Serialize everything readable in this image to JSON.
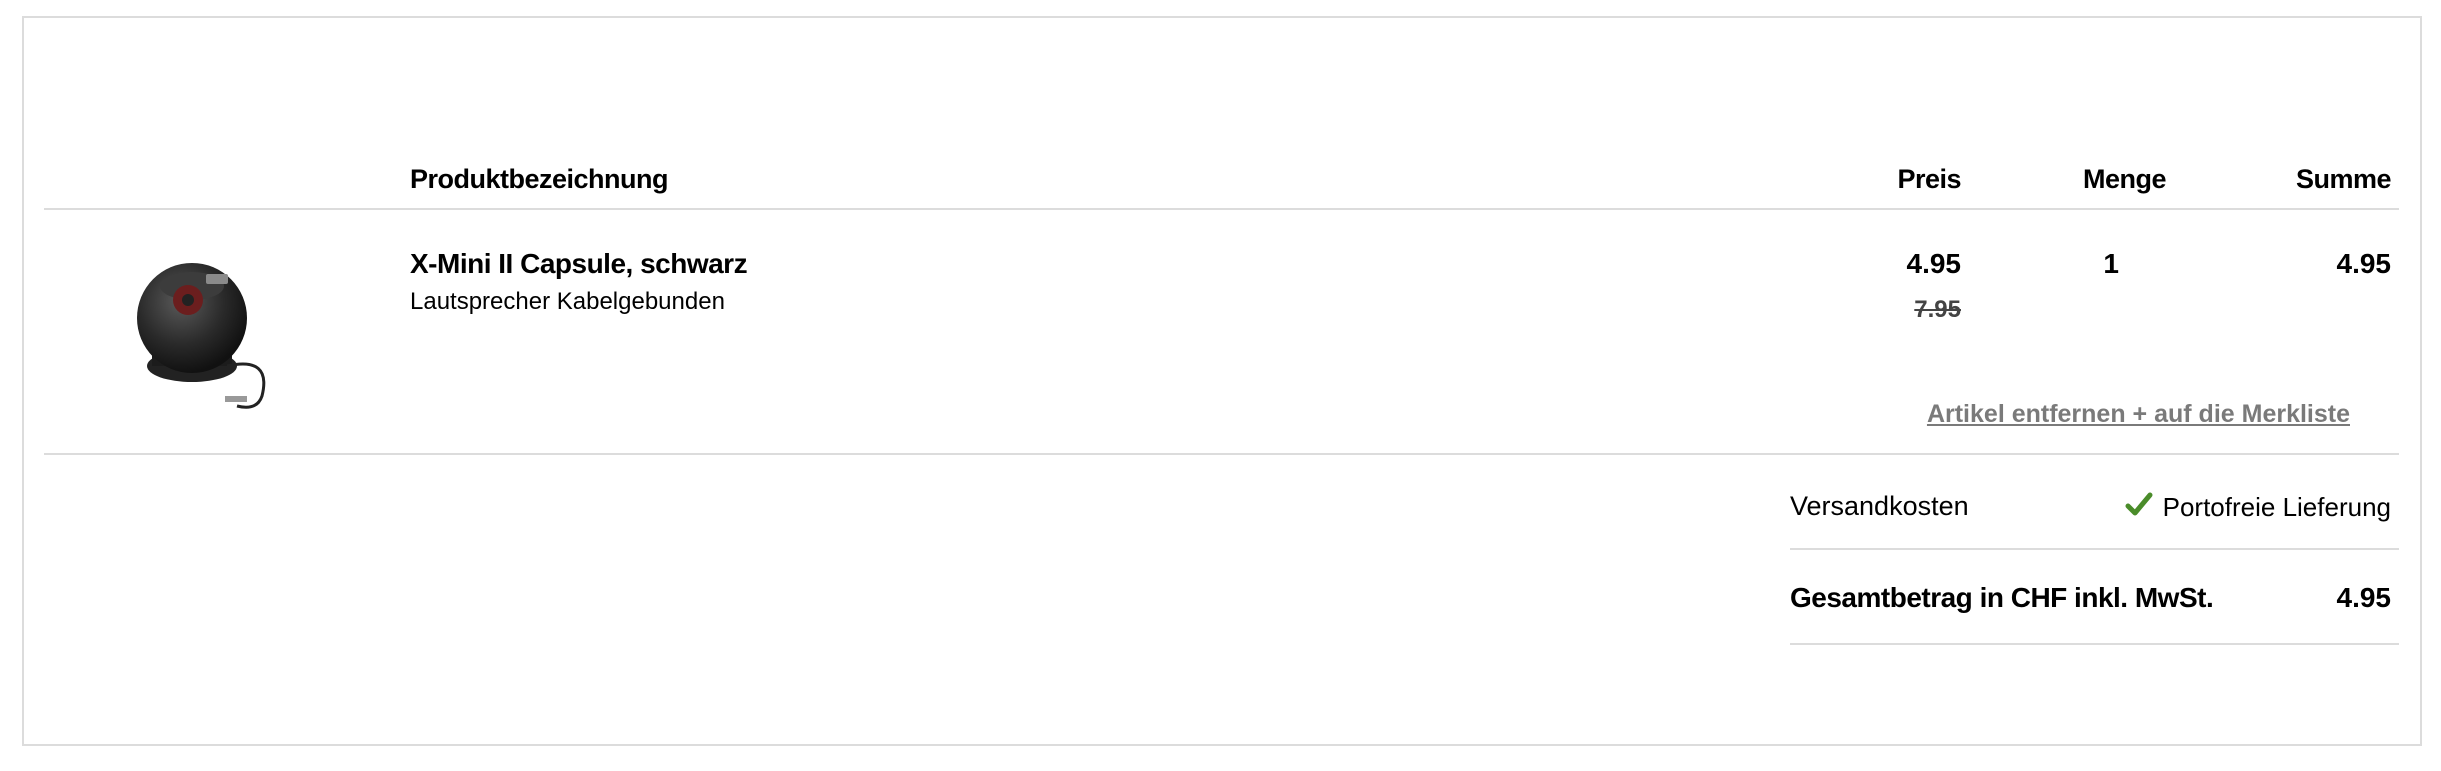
{
  "table": {
    "headers": {
      "product": "Produktbezeichnung",
      "price": "Preis",
      "quantity": "Menge",
      "total": "Summe"
    }
  },
  "item": {
    "image_icon": "speaker-product-image",
    "title": "X-Mini II Capsule, schwarz",
    "subtitle": "Lautsprecher Kabelgebunden",
    "price_current": "4.95",
    "price_old": "7.95",
    "quantity": "1",
    "sum": "4.95",
    "remove_link": "Artikel entfernen + auf die Merkliste"
  },
  "summary": {
    "shipping_label": "Versandkosten",
    "shipping_value": "Portofreie Lieferung",
    "shipping_icon": "check-icon",
    "total_label": "Gesamtbetrag in CHF inkl. MwSt.",
    "total_value": "4.95"
  },
  "colors": {
    "check": "#4a8c2a",
    "link": "#7a7a7a",
    "border": "#dcdcdc"
  }
}
